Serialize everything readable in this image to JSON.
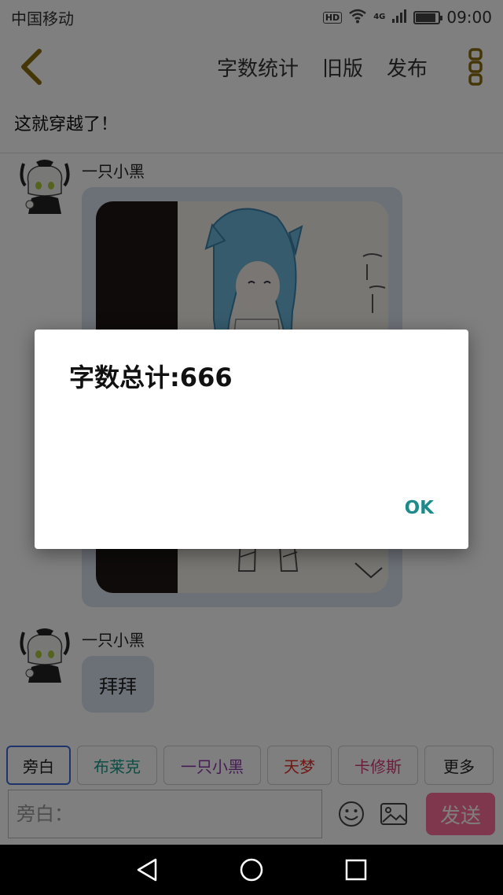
{
  "status_bar": {
    "carrier": "中国移动",
    "network": "4G",
    "hd_label": "HD",
    "time": "09:00",
    "battery_level": 0.9
  },
  "toolbar": {
    "back_icon": "chevron-left-icon",
    "word_count_label": "字数统计",
    "old_version_label": "旧版",
    "publish_label": "发布",
    "more_icon": "more-vertical-icon",
    "accent_color": "#8a6d10"
  },
  "story": {
    "title": "这就穿越了！"
  },
  "messages": [
    {
      "sender": "一只小黑",
      "type": "image"
    },
    {
      "sender": "一只小黑",
      "type": "text",
      "text": "拜拜"
    }
  ],
  "characters": [
    {
      "label": "旁白",
      "color": "#222222",
      "selected": true
    },
    {
      "label": "布莱克",
      "color": "#1a9a8a",
      "selected": false
    },
    {
      "label": "一只小黑",
      "color": "#8a3aa8",
      "selected": false
    },
    {
      "label": "天梦",
      "color": "#e0302a",
      "selected": false
    },
    {
      "label": "卡修斯",
      "color": "#d63a7a",
      "selected": false
    },
    {
      "label": "更多",
      "color": "#222222",
      "selected": false
    }
  ],
  "input": {
    "placeholder": "旁白：",
    "value": "",
    "emoji_icon": "smiley-icon",
    "image_icon": "image-icon",
    "send_label": "发送",
    "send_color": "#ff6f9c"
  },
  "dialog": {
    "message": "字数总计:666",
    "ok_label": "OK"
  }
}
